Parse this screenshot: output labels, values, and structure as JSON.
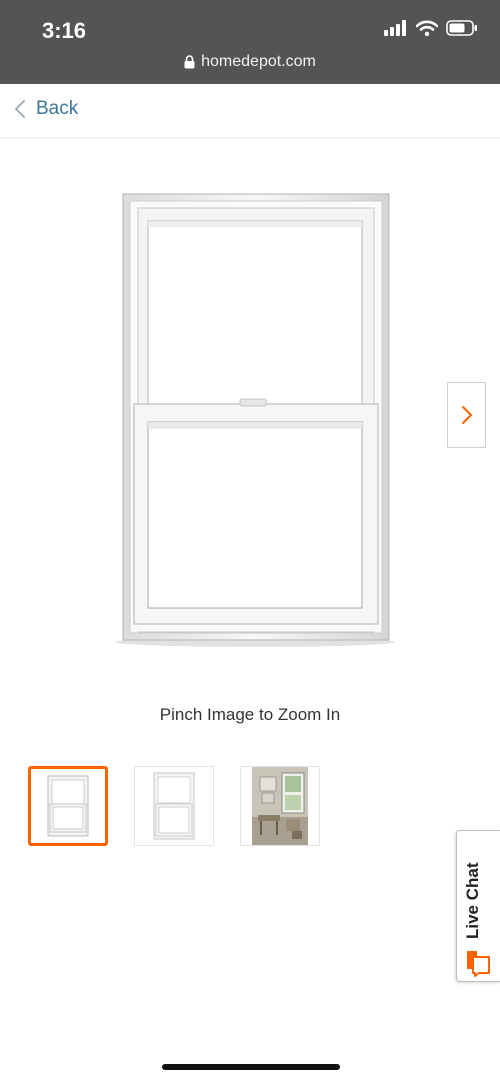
{
  "status_bar": {
    "time": "3:16",
    "url": "homedepot.com",
    "icons": [
      "signal-icon",
      "wifi-icon",
      "battery-icon"
    ]
  },
  "nav": {
    "back_label": "Back"
  },
  "product_image": {
    "icon": "window-image",
    "next_icon": "chevron-right-icon"
  },
  "hint": {
    "text": "Pinch Image to Zoom In"
  },
  "thumbnails": [
    {
      "name": "window-front",
      "selected": true
    },
    {
      "name": "window-front-alt",
      "selected": false
    },
    {
      "name": "room-scene",
      "selected": false
    }
  ],
  "live_chat": {
    "label": "Live Chat",
    "icon": "chat-bubble-icon"
  },
  "colors": {
    "brand_orange": "#f96302",
    "link_blue": "#3e7697",
    "status_bar": "#545454"
  }
}
